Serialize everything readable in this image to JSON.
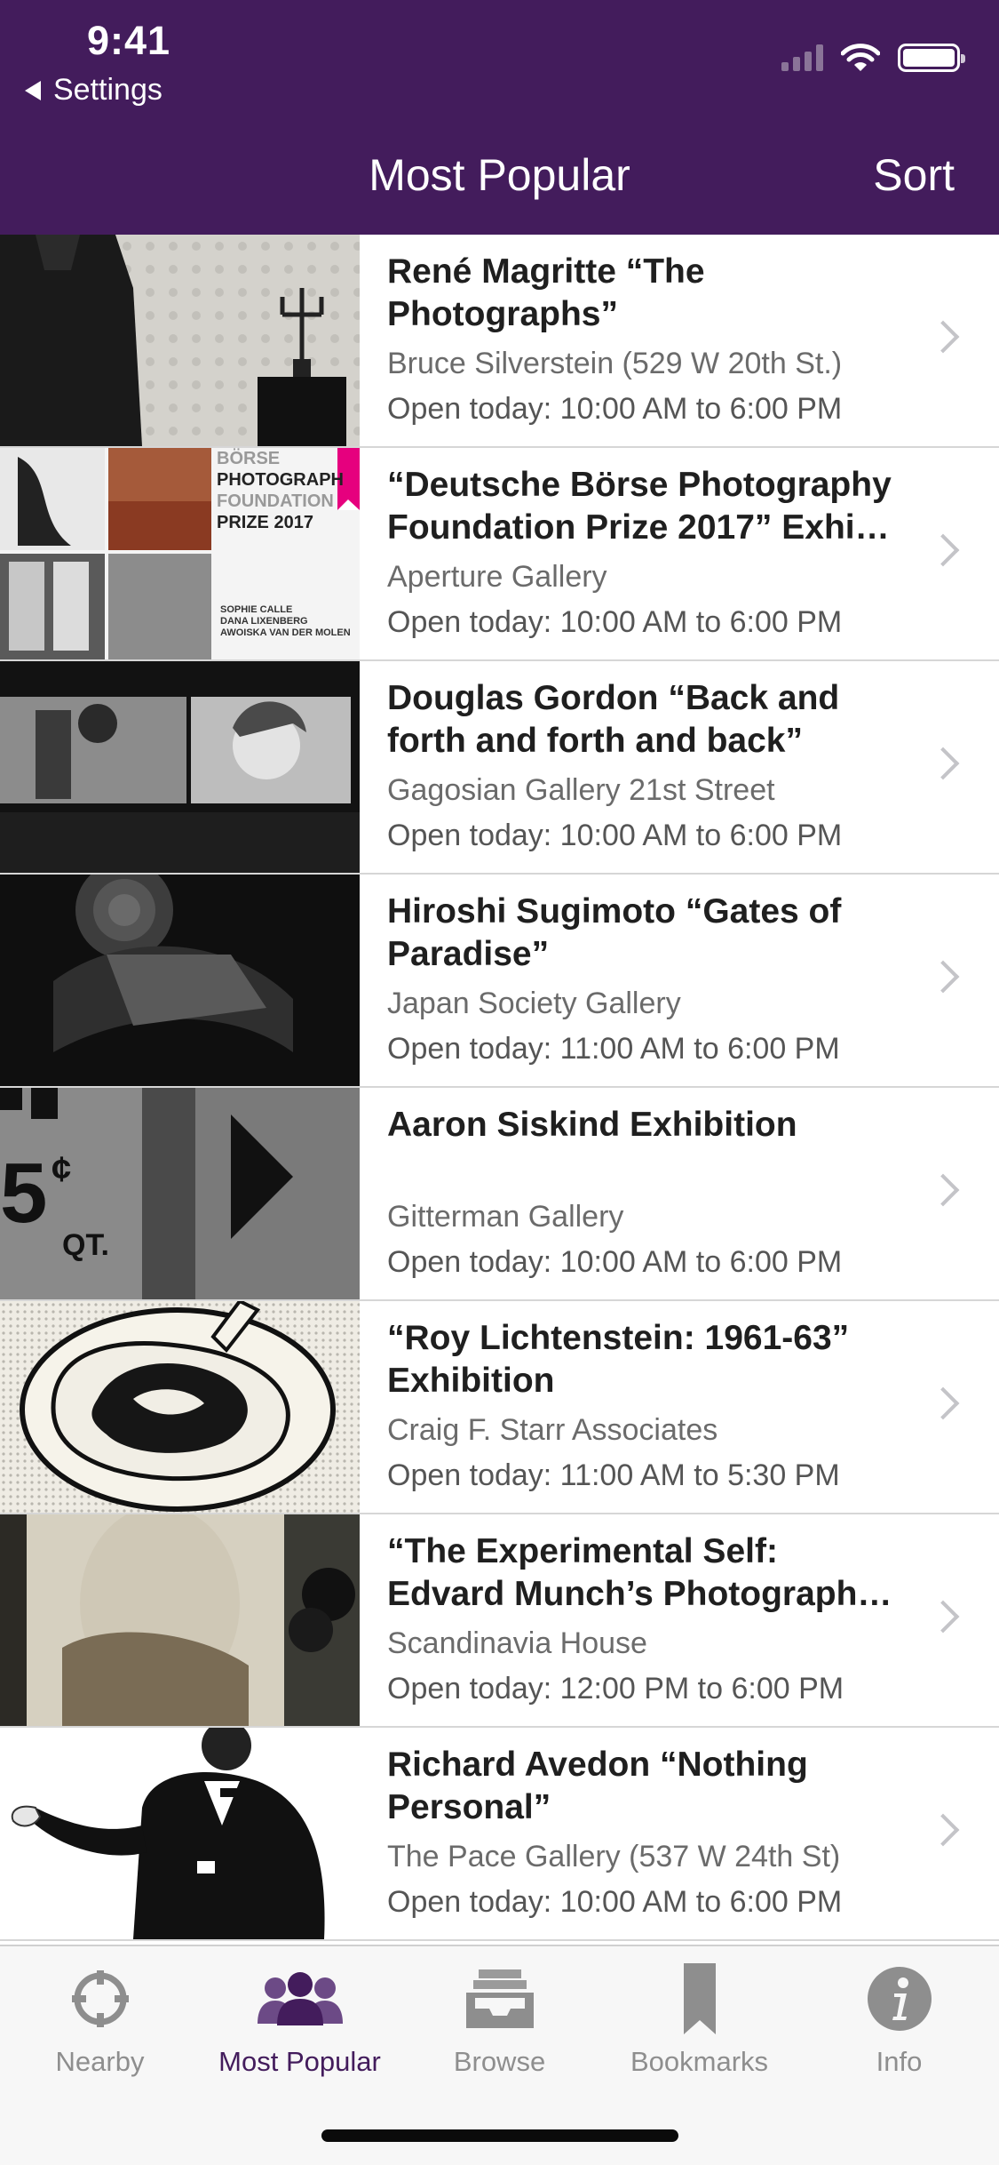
{
  "status_bar": {
    "time": "9:41",
    "back_app": "Settings"
  },
  "nav": {
    "title": "Most Popular",
    "sort_label": "Sort"
  },
  "exhibitions": [
    {
      "title": "René Magritte “The Photographs”",
      "venue": "Bruce Silverstein (529 W 20th St.)",
      "hours": "Open today: 10:00 AM to 6:00 PM"
    },
    {
      "title": "“Deutsche Börse Photography Foundation Prize 2017” Exhi…",
      "venue": "Aperture Gallery",
      "hours": "Open today: 10:00 AM to 6:00 PM",
      "thumb_text": {
        "line1": "BÖRSE",
        "line2": "PHOTOGRAPH",
        "line3": "FOUNDATION",
        "line4": "PRIZE 2017",
        "names1": "SOPHIE CALLE",
        "names2": "DANA LIXENBERG",
        "names3": "AWOISKA VAN DER MOLEN"
      }
    },
    {
      "title": "Douglas Gordon “Back and forth and forth and back”",
      "venue": "Gagosian Gallery 21st Street",
      "hours": "Open today: 10:00 AM to 6:00 PM"
    },
    {
      "title": "Hiroshi Sugimoto “Gates of Paradise”",
      "venue": "Japan Society Gallery",
      "hours": "Open today: 11:00 AM to 6:00 PM"
    },
    {
      "title": "Aaron Siskind Exhibition",
      "venue": "Gitterman Gallery",
      "hours": "Open today: 10:00 AM to 6:00 PM",
      "thumb_text": {
        "big": "5",
        "cents": "¢",
        "qt": "QT."
      }
    },
    {
      "title": "“Roy Lichtenstein: 1961-63” Exhibition",
      "venue": "Craig F. Starr Associates",
      "hours": "Open today: 11:00 AM to 5:30 PM"
    },
    {
      "title": "“The Experimental Self: Edvard Munch’s Photograph…",
      "venue": "Scandinavia House",
      "hours": "Open today: 12:00 PM to 6:00 PM"
    },
    {
      "title": "Richard Avedon “Nothing Personal”",
      "venue": "The Pace Gallery (537 W 24th St)",
      "hours": "Open today: 10:00 AM to 6:00 PM"
    }
  ],
  "tabs": [
    {
      "label": "Nearby",
      "icon": "crosshair-icon"
    },
    {
      "label": "Most Popular",
      "icon": "people-icon",
      "active": true
    },
    {
      "label": "Browse",
      "icon": "inbox-tray-icon"
    },
    {
      "label": "Bookmarks",
      "icon": "bookmark-icon"
    },
    {
      "label": "Info",
      "icon": "info-icon"
    }
  ],
  "colors": {
    "brand": "#431c5c",
    "tab_inactive": "#8e8e8e",
    "separator": "#d6d6d6"
  }
}
